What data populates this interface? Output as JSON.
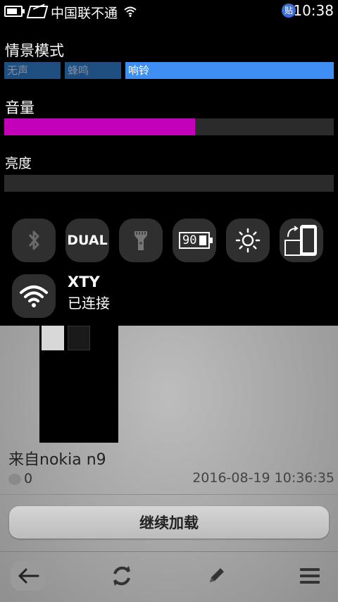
{
  "status_bar": {
    "carrier": "中国联不通",
    "time": "10:38",
    "badge": "贴"
  },
  "profile": {
    "title": "情景模式",
    "options": [
      {
        "label": "无声",
        "selected": false
      },
      {
        "label": "蜂鸣",
        "selected": false
      },
      {
        "label": "响铃",
        "selected": true
      }
    ]
  },
  "volume": {
    "title": "音量",
    "level": 0.58,
    "color": "#c300ba"
  },
  "brightness": {
    "title": "亮度",
    "level": 0.0
  },
  "quick_toggles": [
    {
      "icon": "bluetooth-icon",
      "label": ""
    },
    {
      "icon": "dual-sim-icon",
      "label": "DUAL"
    },
    {
      "icon": "flashlight-icon",
      "label": ""
    },
    {
      "icon": "battery-percent-icon",
      "label": "90"
    },
    {
      "icon": "brightness-icon",
      "label": ""
    },
    {
      "icon": "rotate-screen-icon",
      "label": ""
    }
  ],
  "wifi": {
    "network_name": "XTY",
    "status": "已连接"
  },
  "post": {
    "title": "来自nokia n9",
    "comment_count": "0",
    "timestamp": "2016-08-19 10:36:35"
  },
  "load_more_label": "继续加载",
  "toolbar": {
    "items": [
      "back-icon",
      "refresh-icon",
      "edit-icon",
      "menu-icon"
    ]
  }
}
